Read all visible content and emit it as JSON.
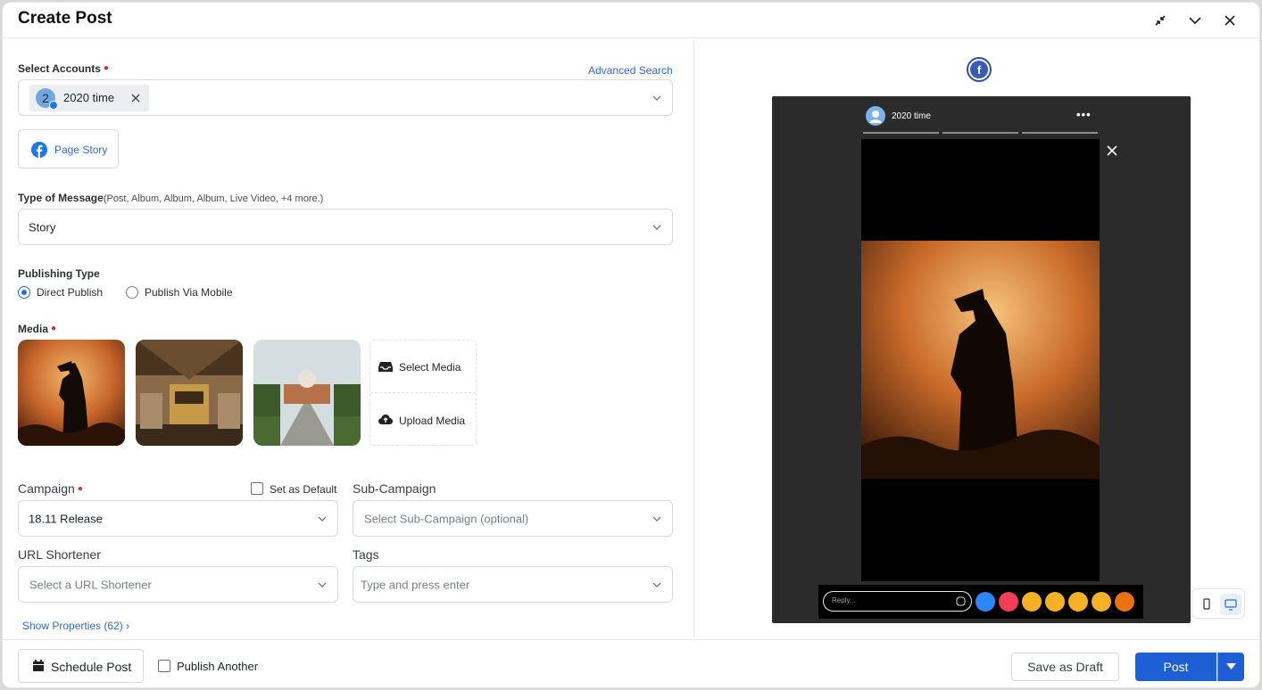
{
  "header": {
    "title": "Create Post"
  },
  "accounts": {
    "label": "Select Accounts",
    "advanced_search": "Advanced Search",
    "chip_avatar_letter": "2",
    "chip_name": "2020 time"
  },
  "page_story": {
    "label": "Page Story"
  },
  "message_type": {
    "label": "Type of Message",
    "sub": "(Post, Album, Album, Album, Live Video, +4 more.)",
    "value": "Story"
  },
  "publishing": {
    "label": "Publishing Type",
    "options": [
      "Direct Publish",
      "Publish Via Mobile"
    ],
    "selected": "Direct Publish"
  },
  "media": {
    "label": "Media",
    "select_label": "Select Media",
    "upload_label": "Upload Media"
  },
  "campaign": {
    "label": "Campaign",
    "default_label": "Set as Default",
    "value": "18.11 Release"
  },
  "sub_campaign": {
    "label": "Sub-Campaign",
    "placeholder": "Select Sub-Campaign (optional)"
  },
  "url_shortener": {
    "label": "URL Shortener",
    "placeholder": "Select a URL Shortener"
  },
  "tags": {
    "label": "Tags",
    "placeholder": "Type and press enter"
  },
  "properties": {
    "link": "Show Properties (62)"
  },
  "preview": {
    "network_letter": "f",
    "account_name": "2020 time",
    "more": "•••",
    "reply_placeholder": "Reply...",
    "reactions": [
      "like",
      "love",
      "care",
      "haha",
      "wow",
      "sad",
      "angry"
    ]
  },
  "footer": {
    "schedule": "Schedule Post",
    "publish_another": "Publish Another",
    "draft": "Save as Draft",
    "post": "Post"
  },
  "colors": {
    "accent": "#2f6ad8",
    "post_button": "#1f5fd6",
    "facebook": "#1877f2",
    "required": "#d03030"
  }
}
